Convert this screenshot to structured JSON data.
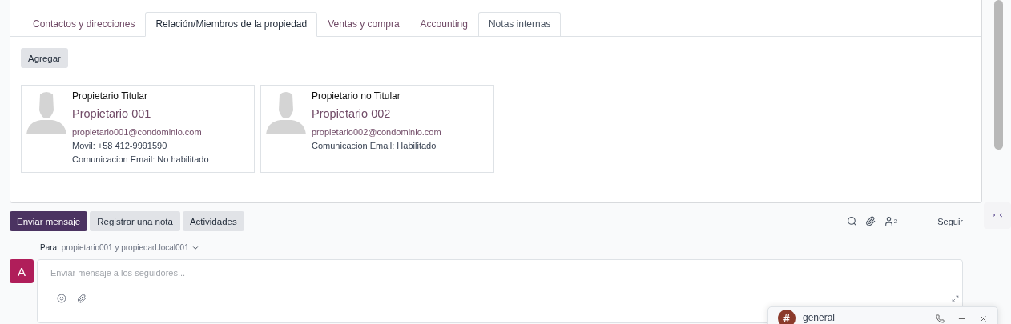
{
  "tabs": [
    {
      "label": "Contactos y direcciones",
      "selected": false
    },
    {
      "label": "Relación/Miembros de la propiedad",
      "selected": true
    },
    {
      "label": "Ventas y compra",
      "selected": false
    },
    {
      "label": "Accounting",
      "selected": false
    },
    {
      "label": "Notas internas",
      "selected": false,
      "bordered": true
    }
  ],
  "add_button": "Agregar",
  "members": [
    {
      "role": "Propietario Titular",
      "name": "Propietario 001",
      "email": "propietario001@condominio.com",
      "lines": [
        "Movil: +58 412-9991590",
        "Comunicacion Email: No habilitado"
      ]
    },
    {
      "role": "Propietario no Titular",
      "name": "Propietario 002",
      "email": "propietario002@condominio.com",
      "lines": [
        "Comunicacion Email: Habilitado"
      ]
    }
  ],
  "chatter": {
    "actions": [
      {
        "label": "Enviar mensaje",
        "selected": true
      },
      {
        "label": "Registrar una nota",
        "selected": false
      },
      {
        "label": "Actividades",
        "selected": false
      }
    ],
    "followers_count": "2",
    "follow": "Seguir",
    "to_label": "Para:",
    "to_value": "propietario001 y propiedad.local001",
    "avatar": "A",
    "placeholder": "Enviar mensaje a los seguidores..."
  },
  "chat_window": {
    "icon": "#",
    "title": "general"
  }
}
